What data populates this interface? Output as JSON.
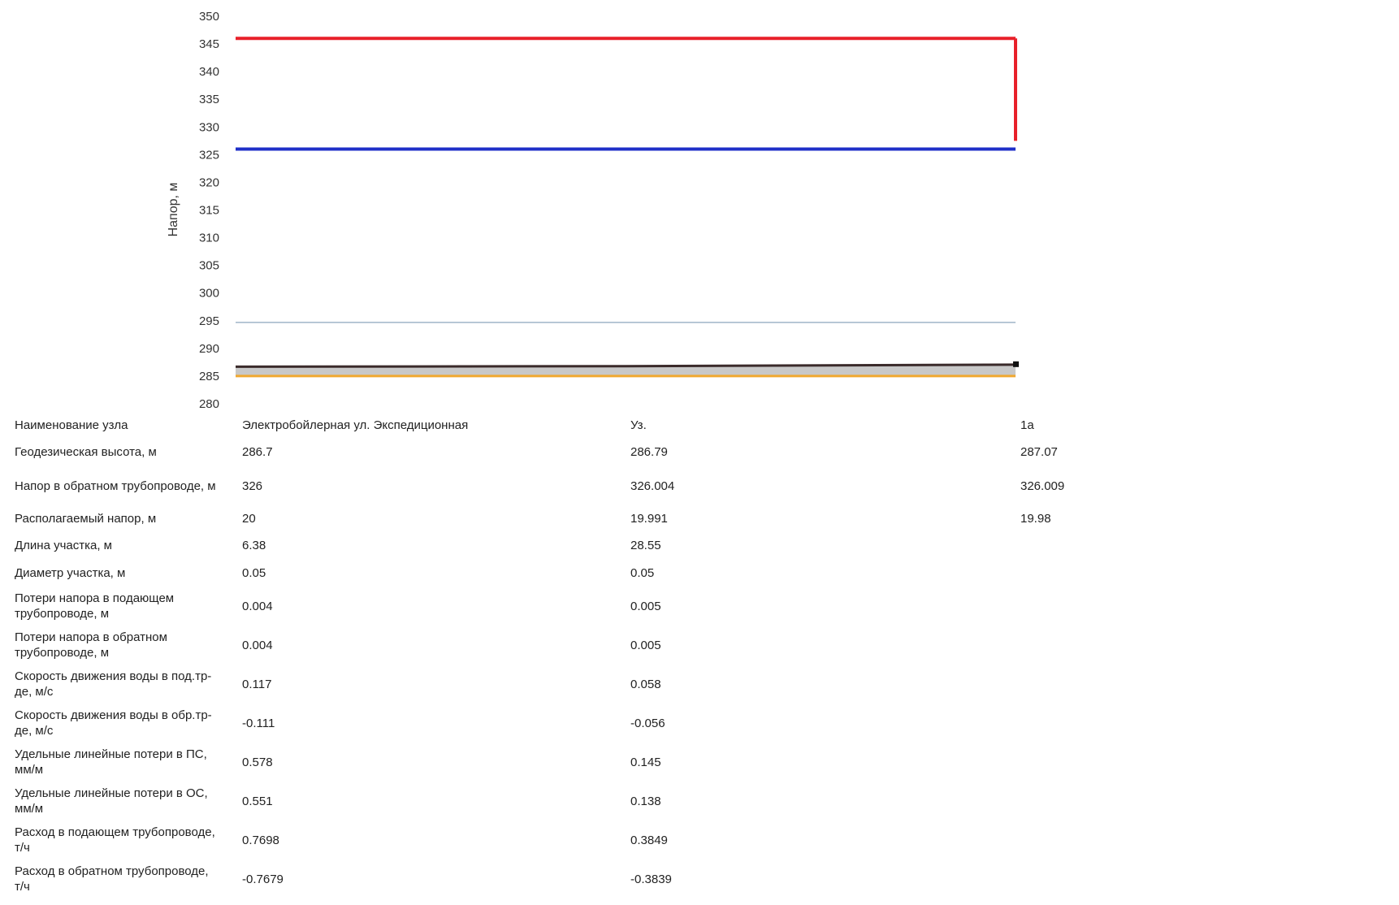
{
  "chart_data": {
    "type": "line",
    "ylabel": "Напор, м",
    "ylim": [
      280,
      350
    ],
    "yticks": [
      350,
      345,
      340,
      335,
      330,
      325,
      320,
      315,
      310,
      305,
      300,
      295,
      290,
      285,
      280
    ],
    "x": [
      0,
      1,
      2
    ],
    "series": [
      {
        "key": "supply",
        "color": "#e8202a",
        "values": [
          346,
          346,
          346
        ]
      },
      {
        "key": "return",
        "color": "#1f2fc8",
        "values": [
          326,
          326.004,
          326.009
        ]
      },
      {
        "key": "ref_line",
        "color": "#9fb4c8",
        "values": [
          294.7,
          294.7,
          294.7
        ]
      },
      {
        "key": "geodetic",
        "color": "#3a2a2a",
        "values": [
          286.7,
          286.79,
          287.07
        ]
      },
      {
        "key": "base",
        "color": "#f0a830",
        "values": [
          285,
          285,
          285
        ]
      }
    ],
    "drop_line": {
      "color": "#e8202a",
      "x": 2,
      "from": 346,
      "to": 327.5
    },
    "end_marker": {
      "color": "#111111",
      "x": 2,
      "y": 287.07
    },
    "fill_color": "#c8c8c8"
  },
  "table": {
    "rows": [
      {
        "label": "Наименование узла",
        "values": [
          "Электробойлерная ул. Экспедиционная",
          "Уз.",
          "1а"
        ]
      },
      {
        "label": "Геодезическая высота, м",
        "values": [
          "286.7",
          "286.79",
          "287.07"
        ]
      },
      {
        "label": "Напор в обратном трубопроводе, м",
        "values": [
          "326",
          "326.004",
          "326.009"
        ]
      },
      {
        "label": "Располагаемый напор, м",
        "values": [
          "20",
          "19.991",
          "19.98"
        ]
      },
      {
        "label": "Длина участка, м",
        "values": [
          "6.38",
          "28.55",
          ""
        ]
      },
      {
        "label": "Диаметр участка, м",
        "values": [
          "0.05",
          "0.05",
          ""
        ]
      },
      {
        "label": "Потери напора в подающем трубопроводе, м",
        "values": [
          "0.004",
          "0.005",
          ""
        ]
      },
      {
        "label": "Потери напора в обратном трубопроводе, м",
        "values": [
          "0.004",
          "0.005",
          ""
        ]
      },
      {
        "label": "Скорость движения воды в под.тр-де, м/с",
        "values": [
          "0.117",
          "0.058",
          ""
        ]
      },
      {
        "label": "Скорость движения воды в обр.тр-де, м/с",
        "values": [
          "-0.111",
          "-0.056",
          ""
        ]
      },
      {
        "label": "Удельные линейные потери в ПС, мм/м",
        "values": [
          "0.578",
          "0.145",
          ""
        ]
      },
      {
        "label": "Удельные линейные потери в ОС, мм/м",
        "values": [
          "0.551",
          "0.138",
          ""
        ]
      },
      {
        "label": "Расход в подающем трубопроводе, т/ч",
        "values": [
          "0.7698",
          "0.3849",
          ""
        ]
      },
      {
        "label": "Расход в обратном трубопроводе, т/ч",
        "values": [
          "-0.7679",
          "-0.3839",
          ""
        ]
      }
    ]
  }
}
